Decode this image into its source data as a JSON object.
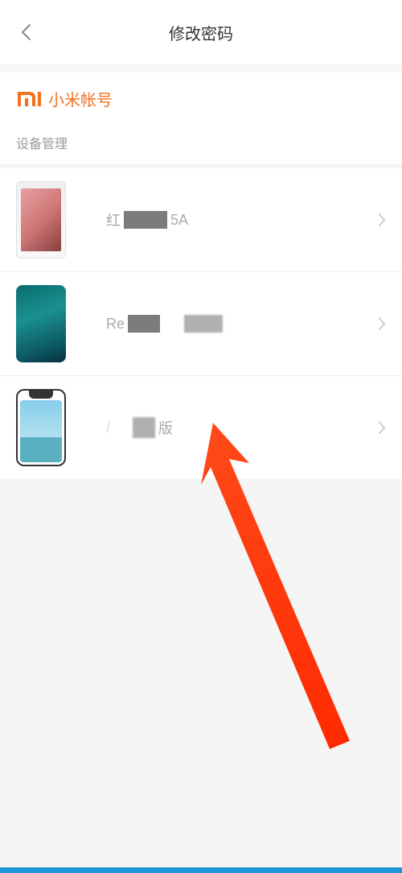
{
  "header": {
    "title": "修改密码"
  },
  "account": {
    "brand": "小米帐号"
  },
  "section": {
    "label": "设备管理"
  },
  "devices": [
    {
      "prefix": "红",
      "suffix": "5A"
    },
    {
      "prefix": "Re",
      "suffix": ""
    },
    {
      "prefix": "",
      "suffix": "版"
    }
  ]
}
